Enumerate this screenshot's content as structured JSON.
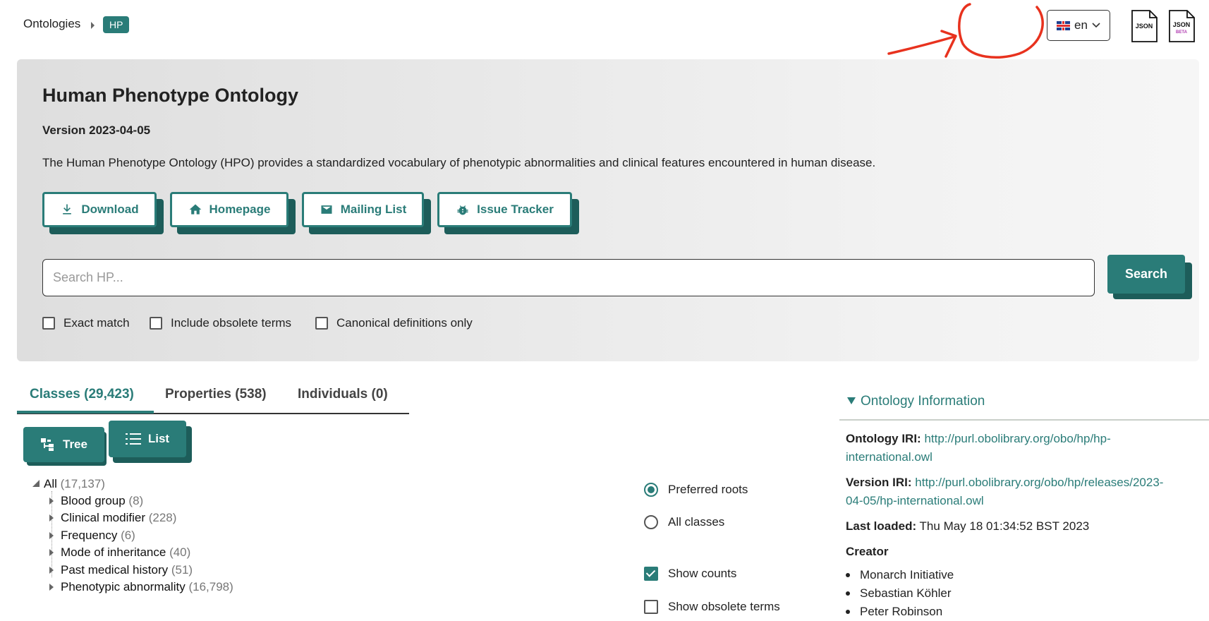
{
  "breadcrumb": {
    "root": "Ontologies",
    "current": "HP"
  },
  "language": {
    "flag": "uk-flag",
    "code": "en"
  },
  "json_links": [
    {
      "label": "JSON",
      "sub": ""
    },
    {
      "label": "JSON",
      "sub": "BETA"
    }
  ],
  "ontology": {
    "title": "Human Phenotype Ontology",
    "version": "Version 2023-04-05",
    "description": "The Human Phenotype Ontology (HPO) provides a standardized vocabulary of phenotypic abnormalities and clinical features encountered in human disease."
  },
  "actions": [
    {
      "label": "Download",
      "icon": "download-icon"
    },
    {
      "label": "Homepage",
      "icon": "home-icon"
    },
    {
      "label": "Mailing List",
      "icon": "mail-icon"
    },
    {
      "label": "Issue Tracker",
      "icon": "bug-icon"
    }
  ],
  "search": {
    "placeholder": "Search HP...",
    "button": "Search"
  },
  "search_options": [
    "Exact match",
    "Include obsolete terms",
    "Canonical definitions only"
  ],
  "tabs": [
    "Classes (29,423)",
    "Properties (538)",
    "Individuals (0)"
  ],
  "views": {
    "tree": "Tree",
    "list": "List"
  },
  "tree": {
    "root": {
      "label": "All",
      "count": "(17,137)"
    },
    "children": [
      {
        "label": "Blood group",
        "count": "(8)"
      },
      {
        "label": "Clinical modifier",
        "count": "(228)"
      },
      {
        "label": "Frequency",
        "count": "(6)"
      },
      {
        "label": "Mode of inheritance",
        "count": "(40)"
      },
      {
        "label": "Past medical history",
        "count": "(51)"
      },
      {
        "label": "Phenotypic abnormality",
        "count": "(16,798)"
      }
    ]
  },
  "tree_options": {
    "preferred_roots": "Preferred roots",
    "all_classes": "All classes",
    "show_counts": "Show counts",
    "show_obsolete": "Show obsolete terms"
  },
  "info": {
    "heading": "Ontology Information",
    "iri_label": "Ontology IRI:",
    "iri_1": "http://purl.obolibrary.org/obo/hp/hp-",
    "iri_2": "international.owl",
    "version_iri_label": "Version IRI:",
    "version_iri_1": "http://purl.obolibrary.org/obo/hp/releases/2023-",
    "version_iri_2": "04-05/hp-international.owl",
    "last_loaded_label": "Last loaded:",
    "last_loaded": "Thu May 18 01:34:52 BST 2023",
    "creator_label": "Creator",
    "creators": [
      "Monarch Initiative",
      "Sebastian Köhler",
      "Peter Robinson"
    ]
  },
  "colors": {
    "accent": "#2a7c78",
    "accent_dark": "#1d5d5a",
    "annotation": "#e8321e"
  }
}
